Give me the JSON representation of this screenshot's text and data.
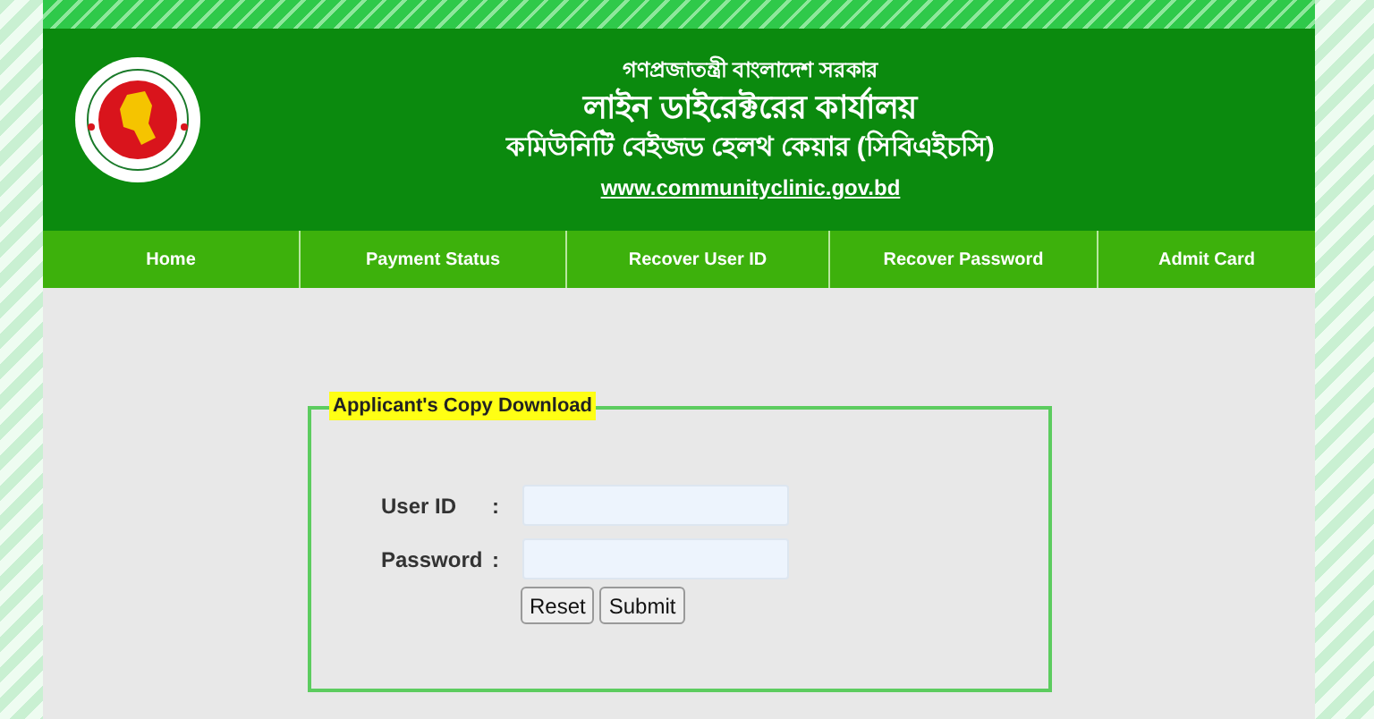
{
  "header": {
    "lines": [
      "গণপ্রজাতন্ত্রী বাংলাদেশ সরকার",
      "লাইন ডাইরেক্টরের কার্যালয়",
      "কমিউনিটি বেইজড হেলথ কেয়ার (সিবিএইচসি)"
    ],
    "website": "www.communityclinic.gov.bd"
  },
  "nav": [
    {
      "label": "Home"
    },
    {
      "label": "Payment Status"
    },
    {
      "label": "Recover User ID"
    },
    {
      "label": "Recover Password"
    },
    {
      "label": "Admit Card"
    }
  ],
  "form": {
    "legend": "Applicant's Copy Download",
    "fields": [
      {
        "label": "User ID",
        "separator": ":"
      },
      {
        "label": "Password",
        "separator": ":"
      }
    ],
    "buttons": [
      "Reset",
      "Submit"
    ]
  }
}
